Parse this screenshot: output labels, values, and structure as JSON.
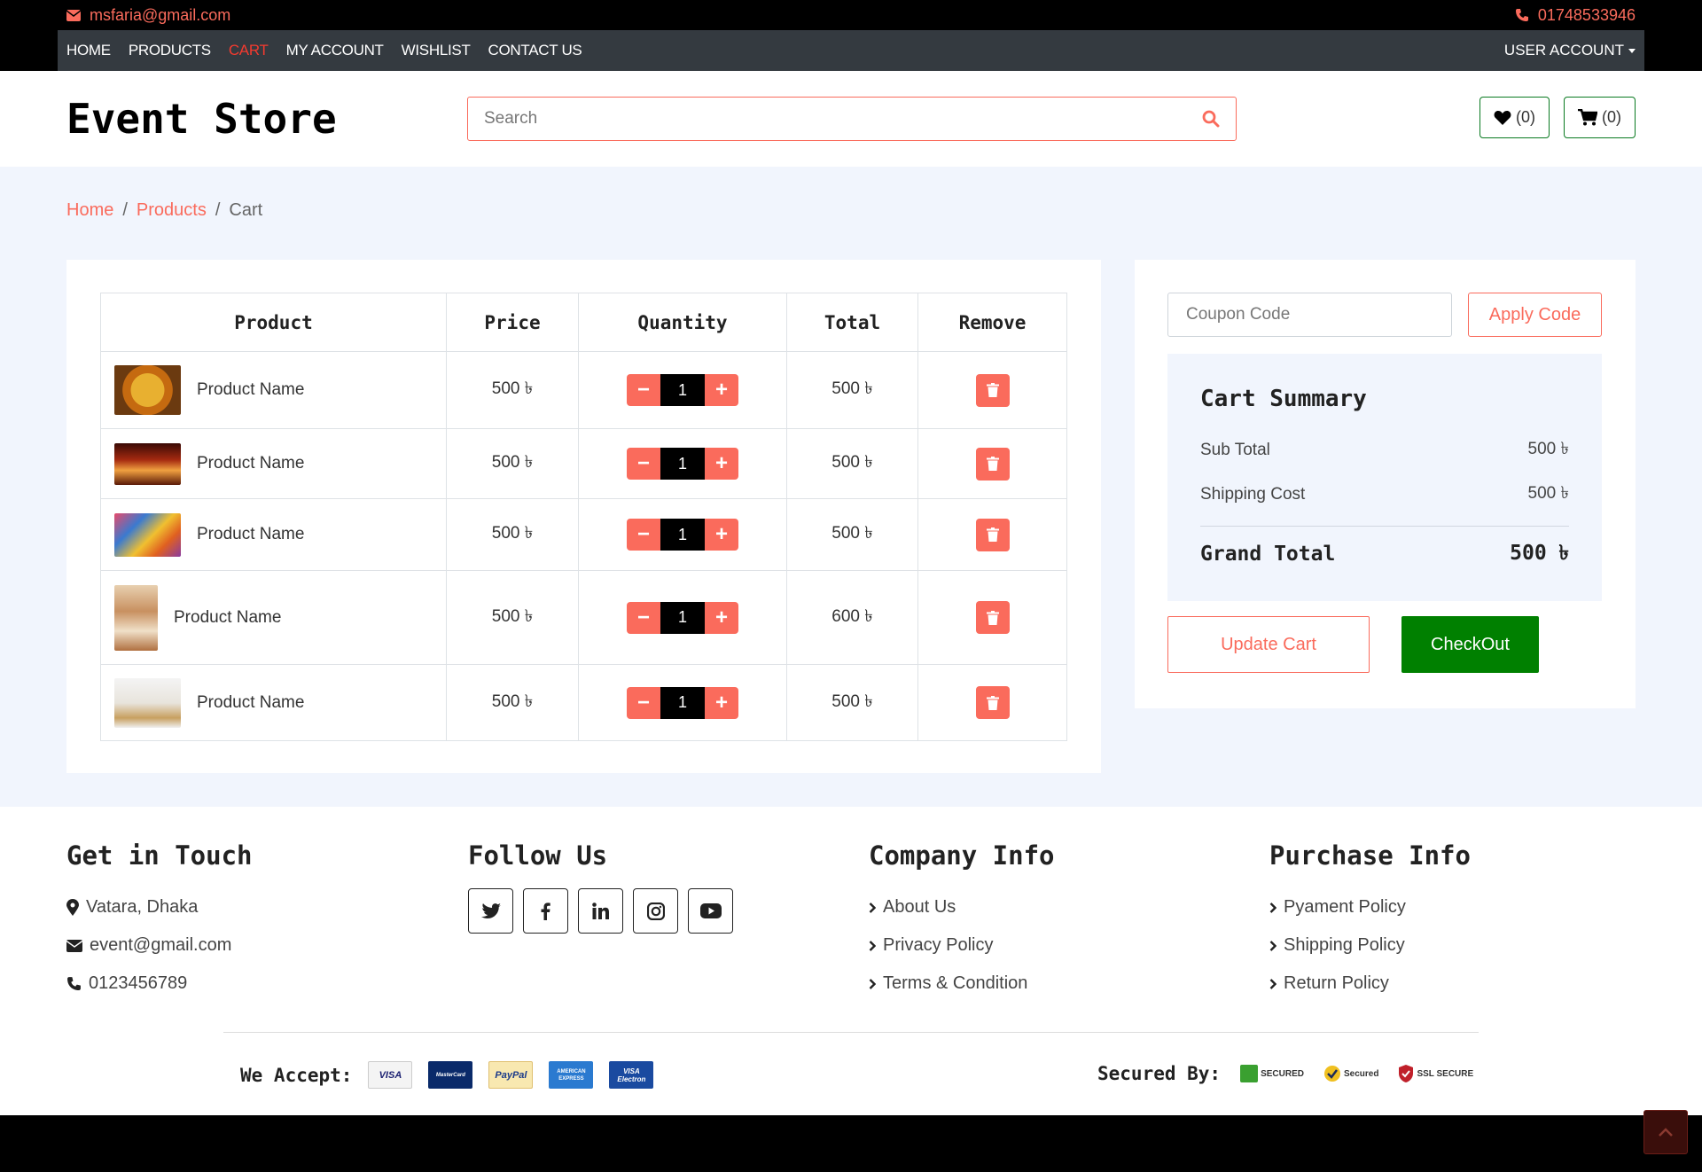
{
  "topbar": {
    "email": "msfaria@gmail.com",
    "phone": "01748533946"
  },
  "nav": {
    "links": [
      "HOME",
      "PRODUCTS",
      "CART",
      "MY ACCOUNT",
      "WISHLIST",
      "CONTACT US"
    ],
    "active": "CART",
    "account": "USER ACCOUNT"
  },
  "header": {
    "logo": "Event Store",
    "search_placeholder": "Search",
    "wishlist_count": "(0)",
    "cart_count": "(0)"
  },
  "breadcrumb": {
    "home": "Home",
    "products": "Products",
    "current": "Cart",
    "sep": "/"
  },
  "cart": {
    "headers": [
      "Product",
      "Price",
      "Quantity",
      "Total",
      "Remove"
    ],
    "rows": [
      {
        "name": "Product Name",
        "price": "500 ৳",
        "qty": "1",
        "total": "500 ৳"
      },
      {
        "name": "Product Name",
        "price": "500 ৳",
        "qty": "1",
        "total": "500 ৳"
      },
      {
        "name": "Product Name",
        "price": "500 ৳",
        "qty": "1",
        "total": "500 ৳"
      },
      {
        "name": "Product Name",
        "price": "500 ৳",
        "qty": "1",
        "total": "600 ৳"
      },
      {
        "name": "Product Name",
        "price": "500 ৳",
        "qty": "1",
        "total": "500 ৳"
      }
    ]
  },
  "summary": {
    "coupon_placeholder": "Coupon Code",
    "apply_label": "Apply Code",
    "title": "Cart Summary",
    "subtotal_label": "Sub Total",
    "subtotal": "500 ৳",
    "shipping_label": "Shipping Cost",
    "shipping": "500 ৳",
    "grand_label": "Grand Total",
    "grand": "500 ৳",
    "update_label": "Update Cart",
    "checkout_label": "CheckOut"
  },
  "footer": {
    "touch": {
      "title": "Get in Touch",
      "address": "Vatara, Dhaka",
      "email": "event@gmail.com",
      "phone": "0123456789"
    },
    "follow": {
      "title": "Follow Us"
    },
    "company": {
      "title": "Company Info",
      "links": [
        "About Us",
        "Privacy Policy",
        "Terms & Condition"
      ]
    },
    "purchase": {
      "title": "Purchase Info",
      "links": [
        "Pyament Policy",
        "Shipping Policy",
        "Return Policy"
      ]
    },
    "we_accept": "We Accept:",
    "secured_by": "Secured By:",
    "cards": [
      "VISA",
      "MasterCard",
      "PayPal",
      "AMERICAN EXPRESS",
      "VISA Electron"
    ],
    "badges": [
      "SECURED",
      "Secured",
      "SSL SECURE"
    ]
  },
  "colors": {
    "accent": "#fa6b5c",
    "green": "#008000",
    "dark": "#343a40",
    "bg": "#f1f5fd"
  }
}
